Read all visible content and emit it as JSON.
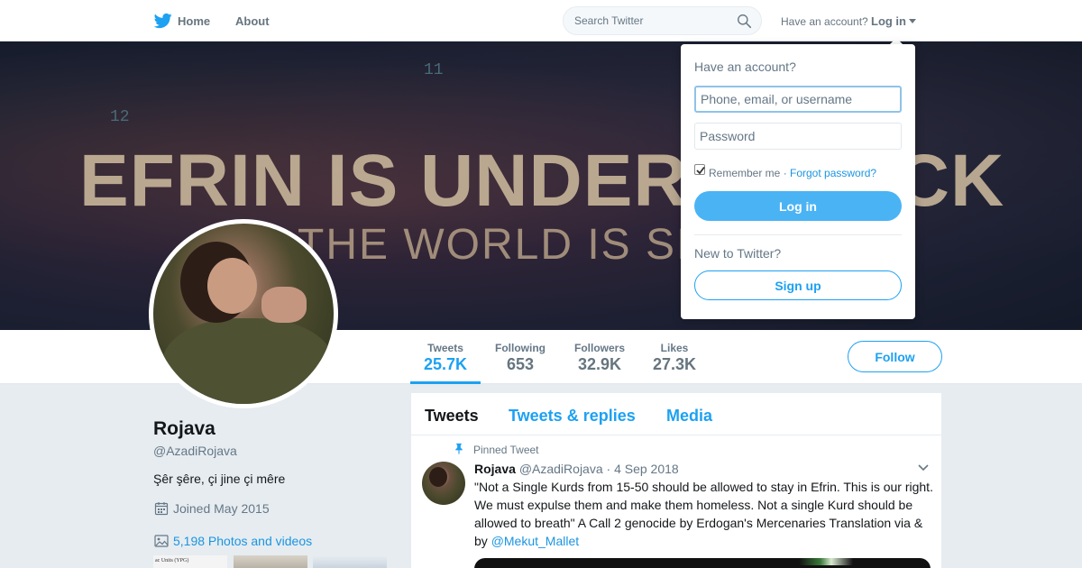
{
  "nav": {
    "home_label": "Home",
    "about_label": "About",
    "search_placeholder": "Search Twitter",
    "have_account_text": "Have an account?",
    "login_label": "Log in",
    "brand_color": "#1da1f2",
    "logo_icon": "twitter-bird-icon"
  },
  "banner": {
    "line1": "EFRIN IS UNDER ATTACK",
    "line2": "THE WORLD IS SILENT",
    "number_top": "11",
    "number_left": "12"
  },
  "profile": {
    "name": "Rojava",
    "handle": "@AzadiRojava",
    "bio": "Şêr şêre, çi jine çi mêre",
    "joined": "Joined May 2015",
    "photos_link": "5,198 Photos and videos",
    "thumb1_caption": "ac Units (YPG)",
    "follow_label": "Follow"
  },
  "stats": [
    {
      "label": "Tweets",
      "value": "25.7K"
    },
    {
      "label": "Following",
      "value": "653"
    },
    {
      "label": "Followers",
      "value": "32.9K"
    },
    {
      "label": "Likes",
      "value": "27.3K"
    }
  ],
  "timeline": {
    "tabs": [
      "Tweets",
      "Tweets & replies",
      "Media"
    ],
    "pinned_label": "Pinned Tweet",
    "tweet": {
      "name": "Rojava",
      "handle": "@AzadiRojava",
      "separator": "·",
      "date": "4 Sep 2018",
      "text": "\"Not a Single Kurds from 15-50 should be allowed to stay in Efrin. This  is our right. We must expulse them and make them homeless. Not a single  Kurd should be allowed to breath\" A Call 2 genocide by Erdogan's Mercenaries Translation via & by",
      "mention": "@Mekut_Mallet"
    }
  },
  "login_dropdown": {
    "heading": "Have an account?",
    "username_placeholder": "Phone, email, or username",
    "password_placeholder": "Password",
    "remember_label": "Remember me ·",
    "forgot_label": "Forgot password?",
    "login_button": "Log in",
    "new_text": "New to Twitter?",
    "signup_button": "Sign up"
  }
}
